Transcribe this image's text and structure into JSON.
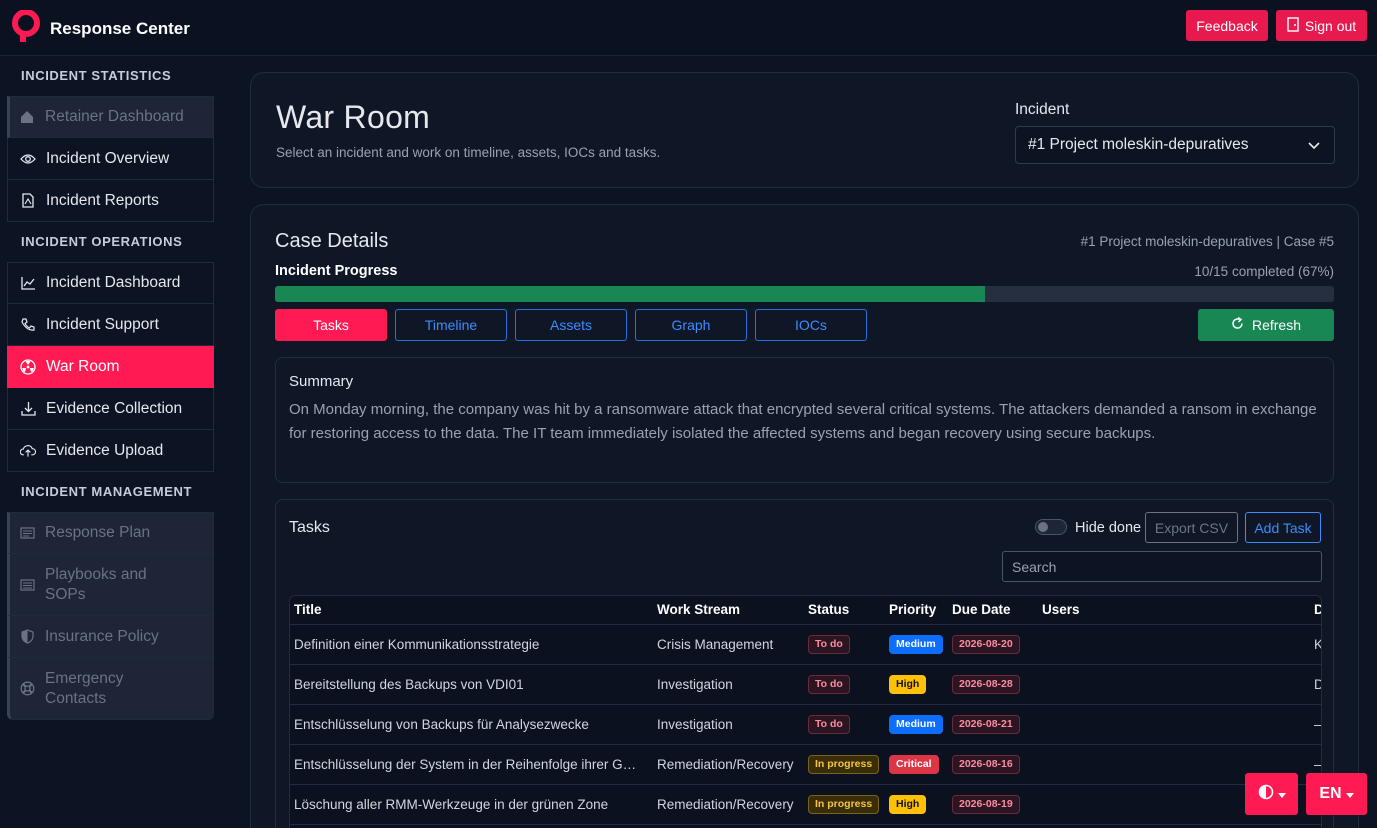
{
  "app": {
    "title": "Response Center",
    "accent_color": "#ff1a53"
  },
  "header": {
    "feedback_label": "Feedback",
    "signout_label": "Sign out"
  },
  "sidebar": {
    "sections": [
      {
        "heading": "INCIDENT STATISTICS",
        "items": [
          {
            "label": "Retainer Dashboard",
            "icon": "home-icon",
            "state": "disabled"
          },
          {
            "label": "Incident Overview",
            "icon": "eye-icon",
            "state": "normal"
          },
          {
            "label": "Incident Reports",
            "icon": "pdf-file-icon",
            "state": "normal"
          }
        ]
      },
      {
        "heading": "INCIDENT OPERATIONS",
        "items": [
          {
            "label": "Incident Dashboard",
            "icon": "line-chart-icon",
            "state": "normal"
          },
          {
            "label": "Incident Support",
            "icon": "phone-icon",
            "state": "normal"
          },
          {
            "label": "War Room",
            "icon": "radiation-icon",
            "state": "active"
          },
          {
            "label": "Evidence Collection",
            "icon": "download-icon",
            "state": "normal"
          },
          {
            "label": "Evidence Upload",
            "icon": "cloud-upload-icon",
            "state": "normal"
          }
        ]
      },
      {
        "heading": "INCIDENT MANAGEMENT",
        "items": [
          {
            "label": "Response Plan",
            "icon": "card-list-icon",
            "state": "disabled"
          },
          {
            "label": "Playbooks and SOPs",
            "icon": "list-icon",
            "state": "disabled"
          },
          {
            "label": "Insurance Policy",
            "icon": "shield-icon",
            "state": "disabled"
          },
          {
            "label": "Emergency Contacts",
            "icon": "lifebuoy-icon",
            "state": "disabled"
          }
        ]
      }
    ]
  },
  "warroom": {
    "title": "War Room",
    "subtitle": "Select an incident and work on timeline, assets, IOCs and tasks.",
    "incident_label": "Incident",
    "incident_selected": "#1 Project moleskin-depuratives"
  },
  "case": {
    "title": "Case Details",
    "reference": "#1 Project moleskin-depuratives | Case #5",
    "progress_label": "Incident Progress",
    "progress_text": "10/15 completed (67%)",
    "progress_fraction": 0.67,
    "tabs": [
      "Tasks",
      "Timeline",
      "Assets",
      "Graph",
      "IOCs"
    ],
    "active_tab": "Tasks",
    "refresh_label": "Refresh"
  },
  "summary": {
    "title": "Summary",
    "text": "On Monday morning, the company was hit by a ransomware attack that encrypted several critical systems. The attackers demanded a ransom in exchange for restoring access to the data. The IT team immediately isolated the affected systems and began recovery using secure backups."
  },
  "tasks": {
    "title": "Tasks",
    "hide_done_label": "Hide done",
    "export_label": "Export CSV",
    "add_label": "Add Task",
    "search_placeholder": "Search",
    "columns": [
      "Title",
      "Work Stream",
      "Status",
      "Priority",
      "Due Date",
      "Users",
      "D"
    ],
    "rows": [
      {
        "title": "Definition einer Kommunikationsstrategie",
        "stream": "Crisis Management",
        "status": "To do",
        "priority": "Medium",
        "due": "2026-08-20",
        "users": "",
        "extra": "K"
      },
      {
        "title": "Bereitstellung des Backups von VDI01",
        "stream": "Investigation",
        "status": "To do",
        "priority": "High",
        "due": "2026-08-28",
        "users": "",
        "extra": "D"
      },
      {
        "title": "Entschlüsselung von Backups für Analysezwecke",
        "stream": "Investigation",
        "status": "To do",
        "priority": "Medium",
        "due": "2026-08-21",
        "users": "",
        "extra": "–"
      },
      {
        "title": "Entschlüsselung der System in der Reihenfolge ihrer G…",
        "stream": "Remediation/Recovery",
        "status": "In progress",
        "priority": "Critical",
        "due": "2026-08-16",
        "users": "",
        "extra": "–"
      },
      {
        "title": "Löschung aller RMM-Werkzeuge in der grünen Zone",
        "stream": "Remediation/Recovery",
        "status": "In progress",
        "priority": "High",
        "due": "2026-08-19",
        "users": "",
        "extra": ""
      }
    ]
  },
  "floating": {
    "theme_icon": "contrast-icon",
    "language": "EN"
  }
}
